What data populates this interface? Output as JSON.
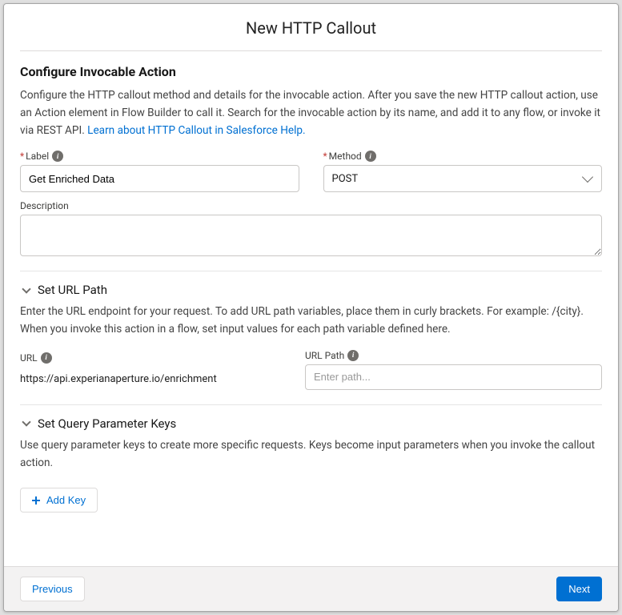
{
  "modal": {
    "title": "New HTTP Callout"
  },
  "intro": {
    "heading": "Configure Invocable Action",
    "body_preamble": "Configure the HTTP callout method and details for the invocable action. After you save the new HTTP callout action, use an Action element in Flow Builder to call it. Search for the invocable action by its name, and add it to any flow, or invoke it via REST API. ",
    "help_link_text": "Learn about HTTP Callout in Salesforce Help."
  },
  "fields": {
    "label": {
      "label": "Label",
      "value": "Get Enriched Data"
    },
    "method": {
      "label": "Method",
      "value": "POST"
    },
    "description": {
      "label": "Description",
      "value": ""
    }
  },
  "url_section": {
    "title": "Set URL Path",
    "desc": "Enter the URL endpoint for your request. To add URL path variables, place them in curly brackets. For example: /{city}. When you invoke this action in a flow, set input values for each path variable defined here.",
    "url_label": "URL",
    "url_value": "https://api.experianaperture.io/enrichment",
    "path_label": "URL Path",
    "path_placeholder": "Enter path..."
  },
  "query_section": {
    "title": "Set Query Parameter Keys",
    "desc": "Use query parameter keys to create more specific requests. Keys become input parameters when you invoke the callout action.",
    "add_key_label": "Add Key"
  },
  "footer": {
    "previous": "Previous",
    "next": "Next"
  }
}
